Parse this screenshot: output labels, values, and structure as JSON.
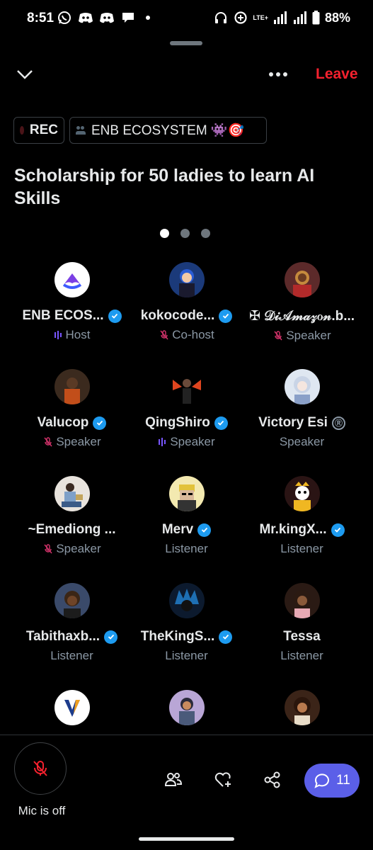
{
  "status_bar": {
    "time": "8:51",
    "network": "LTE+",
    "battery": "88%"
  },
  "header": {
    "leave_label": "Leave"
  },
  "tags": {
    "rec": "REC",
    "community": "ENB ECOSYSTEM 👾🎯"
  },
  "space": {
    "title": "Scholarship for 50 ladies to learn AI Skills"
  },
  "pager": {
    "pages": 3,
    "active": 0
  },
  "participants": [
    {
      "name": "ENB ECOS...",
      "role": "Host",
      "verified": true,
      "status": "speaking"
    },
    {
      "name": "kokocode...",
      "role": "Co-host",
      "verified": true,
      "status": "muted"
    },
    {
      "name": "✠ 𝒟𝒾𝒜𝓂𝒶𝓏ℴ𝓃.b...",
      "role": "Speaker",
      "verified": false,
      "status": "muted"
    },
    {
      "name": "Valucop",
      "role": "Speaker",
      "verified": true,
      "status": "muted"
    },
    {
      "name": "QingShiro",
      "role": "Speaker",
      "verified": true,
      "status": "speaking"
    },
    {
      "name": "Victory Esi",
      "role": "Speaker",
      "verified": false,
      "badge": "Ⓡ",
      "status": "none"
    },
    {
      "name": "~Emediong ...",
      "role": "Speaker",
      "verified": false,
      "status": "muted"
    },
    {
      "name": "Merv",
      "role": "Listener",
      "verified": true,
      "status": "none"
    },
    {
      "name": "Mr.kingX...",
      "role": "Listener",
      "verified": true,
      "status": "none"
    },
    {
      "name": "Tabithaxb...",
      "role": "Listener",
      "verified": true,
      "status": "none"
    },
    {
      "name": "TheKingS...",
      "role": "Listener",
      "verified": true,
      "status": "none"
    },
    {
      "name": "Tessa",
      "role": "Listener",
      "verified": false,
      "status": "none"
    }
  ],
  "bottom_bar": {
    "mic_label": "Mic is off",
    "chat_count": "11"
  },
  "colors": {
    "accent_blue": "#1d9bf0",
    "leave_red": "#f4212e",
    "chat_purple": "#5b5fe8",
    "muted_pink": "#d6336c",
    "speaking_purple": "#7856ff"
  }
}
